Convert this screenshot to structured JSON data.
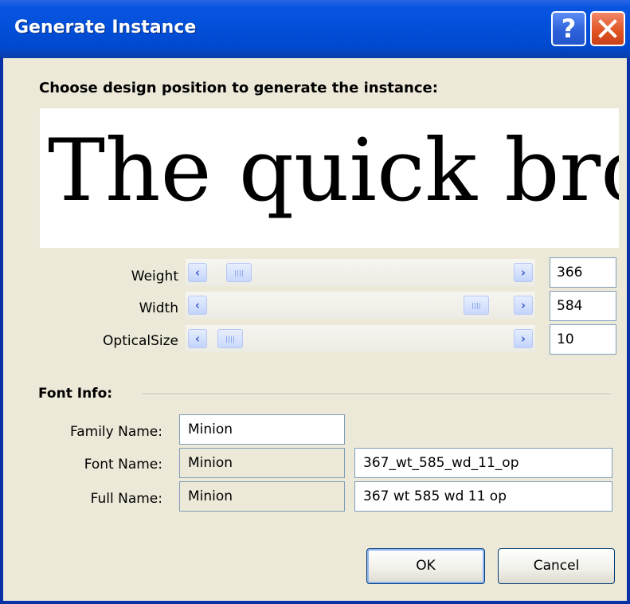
{
  "window": {
    "title": "Generate Instance",
    "help_glyph": "?",
    "icons": {
      "help": "help-icon",
      "close": "close-icon"
    }
  },
  "prompt": "Choose design position to generate the instance:",
  "preview": {
    "sample_text": "The quick bro"
  },
  "axes": [
    {
      "label": "Weight",
      "value": "366",
      "slider_fraction": 0.06
    },
    {
      "label": "Width",
      "value": "584",
      "slider_fraction": 0.92
    },
    {
      "label": "OpticalSize",
      "value": "10",
      "slider_fraction": 0.03
    }
  ],
  "font_info": {
    "group_label": "Font Info:",
    "family": {
      "label": "Family Name:",
      "value": "Minion"
    },
    "font_name": {
      "label": "Font Name:",
      "base": "Minion",
      "suffix": "367_wt_585_wd_11_op"
    },
    "full_name": {
      "label": "Full Name:",
      "base": "Minion",
      "suffix": "367 wt 585 wd 11 op"
    }
  },
  "buttons": {
    "ok": "OK",
    "cancel": "Cancel"
  },
  "colors": {
    "title_bar": "#0250d9",
    "dialog_bg": "#ece9d8",
    "field_border": "#7f9db9",
    "close_button": "#e0521f"
  }
}
